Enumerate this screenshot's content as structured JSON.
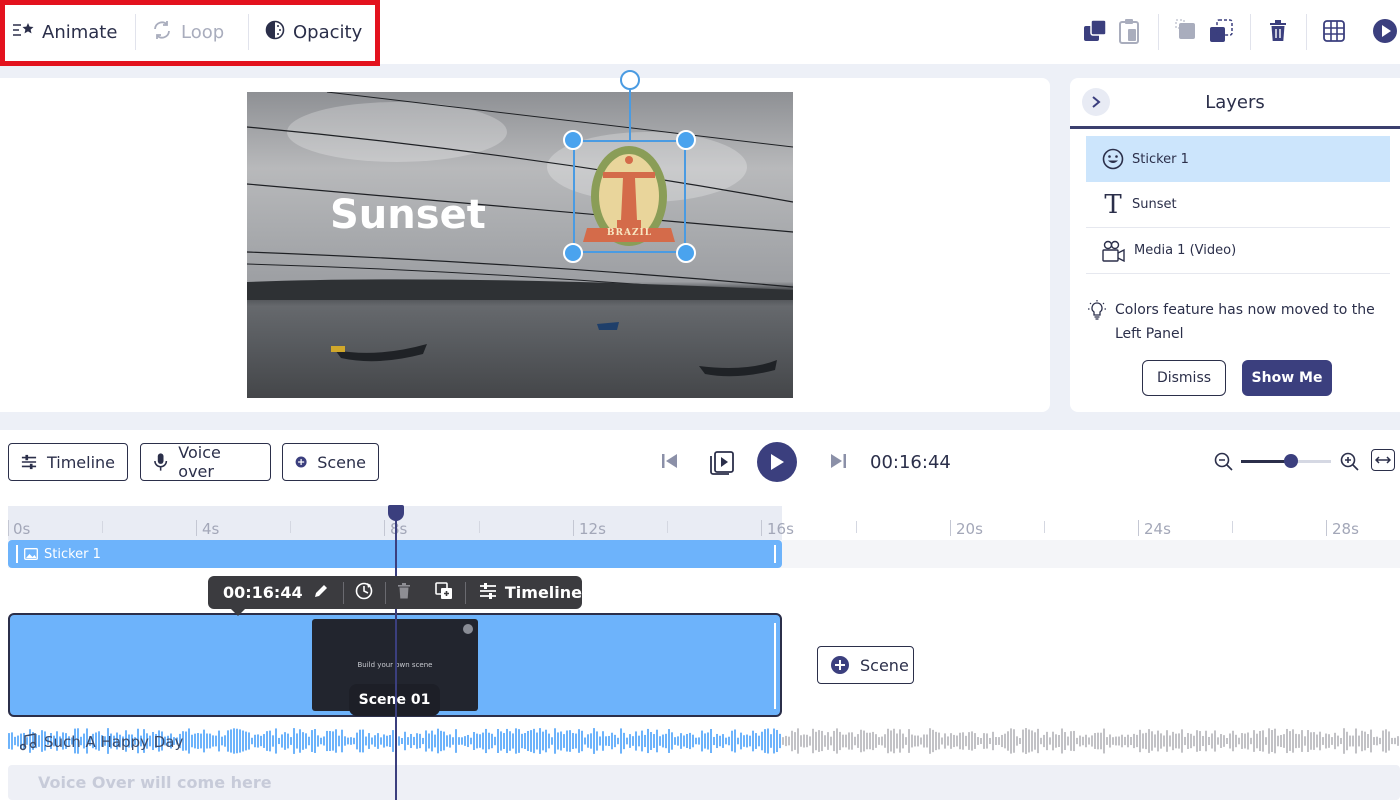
{
  "toolbar": {
    "animate_label": "Animate",
    "loop_label": "Loop",
    "opacity_label": "Opacity"
  },
  "canvas": {
    "overlay_text": "Sunset",
    "sticker_text": "BRAZIL"
  },
  "layers": {
    "title": "Layers",
    "items": [
      {
        "label": "Sticker 1",
        "icon": "smiley-icon"
      },
      {
        "label": "Sunset",
        "icon": "text-icon"
      },
      {
        "label": "Media 1 (Video)",
        "icon": "video-camera-icon"
      }
    ],
    "tip": "Colors feature has now moved to the Left Panel",
    "dismiss_label": "Dismiss",
    "show_me_label": "Show Me"
  },
  "controls": {
    "timeline_label": "Timeline",
    "voice_over_label": "Voice over",
    "scene_label": "Scene",
    "time": "00:16:44",
    "zoom_level": 0.55
  },
  "ruler": {
    "ticks": [
      "0s",
      "4s",
      "8s",
      "12s",
      "16s",
      "20s",
      "24s",
      "28s"
    ]
  },
  "tracks": {
    "sticker_label": "Sticker 1",
    "scene_popup_time": "00:16:44",
    "scene_popup_timeline": "Timeline",
    "scene_thumb_text": "Build your own scene",
    "scene_name": "Scene 01",
    "add_scene_label": "Scene",
    "audio_label": "Such A Happy Day",
    "voice_over_placeholder": "Voice Over will come here"
  },
  "colors": {
    "accent": "#3b3f7e",
    "track_blue": "#6db3fb",
    "highlight_red": "#e3121e",
    "selected_layer": "#cce5fc"
  }
}
